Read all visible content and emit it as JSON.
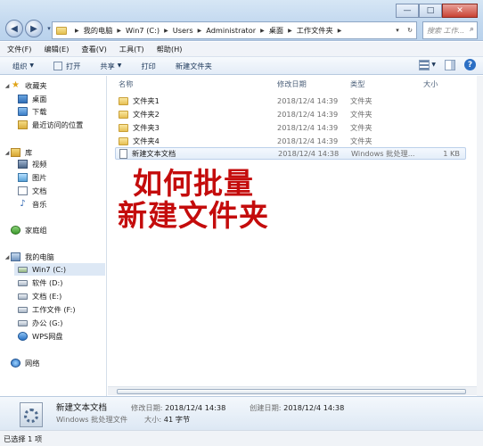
{
  "window": {
    "minimize": "—",
    "maximize": "□",
    "close": "✕"
  },
  "nav": {
    "back": "◀",
    "forward": "▶",
    "history": "▾"
  },
  "address": {
    "crumbs": [
      "我的电脑",
      "Win7 (C:)",
      "Users",
      "Administrator",
      "桌面",
      "工作文件夹"
    ],
    "refresh": "↻"
  },
  "search": {
    "placeholder": "搜索 工作...",
    "icon": "search-icon"
  },
  "menu": [
    "文件(F)",
    "编辑(E)",
    "查看(V)",
    "工具(T)",
    "帮助(H)"
  ],
  "toolbar": {
    "organize": "组织",
    "open": "打开",
    "share": "共享",
    "print": "打印",
    "new_folder": "新建文件夹",
    "help": "?"
  },
  "sidebar": {
    "favorites": "收藏夹",
    "desktop": "桌面",
    "downloads": "下载",
    "recent": "最近访问的位置",
    "libraries": "库",
    "videos": "视频",
    "pictures": "图片",
    "documents": "文档",
    "music": "音乐",
    "homegroup": "家庭组",
    "computer": "我的电脑",
    "drives": [
      "Win7 (C:)",
      "软件 (D:)",
      "文档 (E:)",
      "工作文件 (F:)",
      "办公 (G:)",
      "WPS网盘"
    ],
    "network": "网络"
  },
  "columns": {
    "name": "名称",
    "date": "修改日期",
    "type": "类型",
    "size": "大小"
  },
  "files": [
    {
      "name": "文件夹1",
      "date": "2018/12/4 14:39",
      "type": "文件夹",
      "size": ""
    },
    {
      "name": "文件夹2",
      "date": "2018/12/4 14:39",
      "type": "文件夹",
      "size": ""
    },
    {
      "name": "文件夹3",
      "date": "2018/12/4 14:39",
      "type": "文件夹",
      "size": ""
    },
    {
      "name": "文件夹4",
      "date": "2018/12/4 14:39",
      "type": "文件夹",
      "size": ""
    },
    {
      "name": "新建文本文档",
      "date": "2018/12/4 14:38",
      "type": "Windows 批处理...",
      "size": "1 KB"
    }
  ],
  "overlay": {
    "line1": "如何批量",
    "line2": "新建文件夹"
  },
  "details": {
    "name": "新建文本文档",
    "type": "Windows 批处理文件",
    "modified_label": "修改日期:",
    "modified_value": "2018/12/4 14:38",
    "created_label": "创建日期:",
    "created_value": "2018/12/4 14:38",
    "size_label": "大小:",
    "size_value": "41 字节"
  },
  "status": {
    "text": "已选择 1 项"
  }
}
